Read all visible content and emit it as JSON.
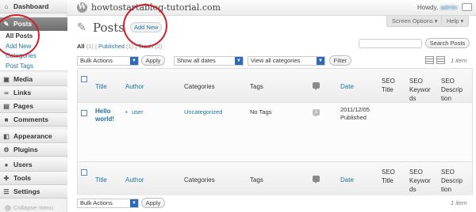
{
  "header": {
    "wp_logo": "W",
    "site_title": "howtostartablog-tutorial.com",
    "howdy_label": "Howdy,",
    "user_name": "admin"
  },
  "sidebar": {
    "dashboard": "Dashboard",
    "posts": "Posts",
    "posts_sub": [
      "All Posts",
      "Add New",
      "Categories",
      "Post Tags"
    ],
    "items": [
      "Media",
      "Links",
      "Pages",
      "Comments",
      "Appearance",
      "Plugins",
      "Users",
      "Tools",
      "Settings"
    ],
    "collapse": "Collapse menu"
  },
  "screen_tabs": {
    "screen_options": "Screen Options ▾",
    "help": "Help ▾"
  },
  "page": {
    "title": "Posts",
    "add_new": "Add New",
    "status": {
      "all": "All",
      "all_count": "(1)",
      "published": "Published",
      "published_count": "(1)",
      "trash": "Trash",
      "trash_count": "(2)"
    },
    "search_button": "Search Posts"
  },
  "filters": {
    "bulk_actions": "Bulk Actions",
    "apply": "Apply",
    "dates": "Show all dates",
    "categories": "View all categories",
    "filter": "Filter",
    "items_count": "1 item"
  },
  "table": {
    "columns": {
      "title": "Title",
      "author": "Author",
      "categories": "Categories",
      "tags": "Tags",
      "date": "Date",
      "seo_title": [
        "SEO",
        "Title"
      ],
      "seo_keywords": [
        "SEO",
        "Keywor",
        "ds"
      ],
      "seo_description": [
        "SEO",
        "Descrip",
        "tion"
      ]
    },
    "rows": [
      {
        "title": [
          "Hello",
          "world!"
        ],
        "author": "user",
        "categories": "Uncategorized",
        "tags": "No Tags",
        "comments": "1",
        "date": "2011/12/05",
        "status": "Published"
      }
    ]
  },
  "colors": {
    "link": "#21759b",
    "annotation": "#d0202a",
    "active_menu": "#6e6e6e"
  }
}
